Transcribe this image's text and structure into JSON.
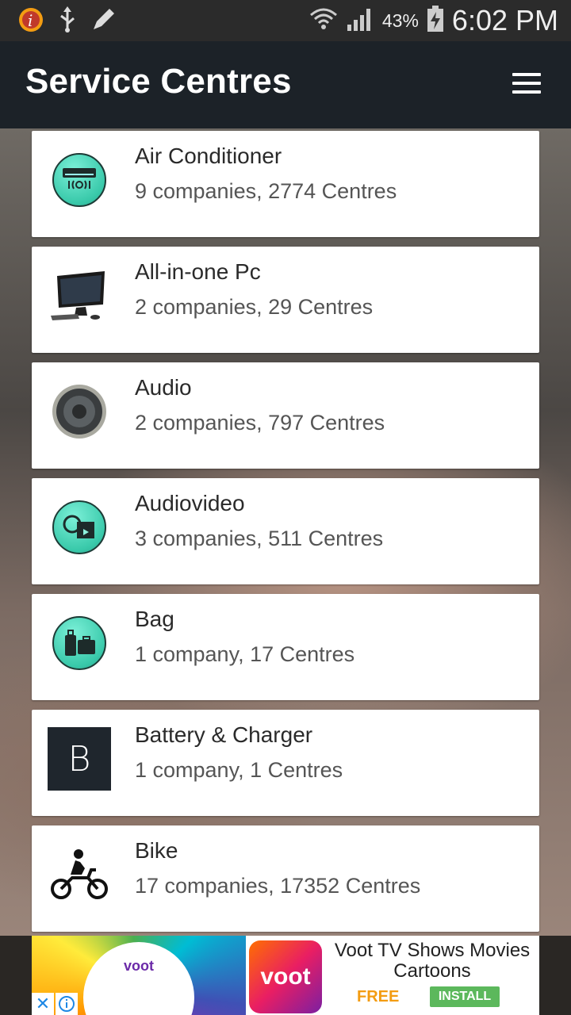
{
  "status_bar": {
    "battery_percent": "43%",
    "time": "6:02 PM"
  },
  "app_bar": {
    "title": "Service Centres"
  },
  "categories": [
    {
      "title": "Air Conditioner",
      "subtitle": "9 companies, 2774 Centres",
      "icon": "air-conditioner-icon"
    },
    {
      "title": "All-in-one Pc",
      "subtitle": "2 companies, 29 Centres",
      "icon": "all-in-one-pc-icon"
    },
    {
      "title": "Audio",
      "subtitle": "2 companies, 797 Centres",
      "icon": "speaker-icon"
    },
    {
      "title": "Audiovideo",
      "subtitle": "3 companies, 511 Centres",
      "icon": "audiovideo-icon"
    },
    {
      "title": "Bag",
      "subtitle": "1 company, 17 Centres",
      "icon": "luggage-icon"
    },
    {
      "title": "Battery & Charger",
      "subtitle": "1 company, 1 Centres",
      "icon": "letter-b-icon",
      "letter": "B"
    },
    {
      "title": "Bike",
      "subtitle": "17 companies, 17352 Centres",
      "icon": "motorbike-icon"
    }
  ],
  "ad": {
    "brand": "voot",
    "title": "Voot TV Shows Movies Cartoons",
    "free_label": "FREE",
    "install_label": "INSTALL",
    "install_color": "#5cb85c",
    "free_color": "#f39c12"
  },
  "colors": {
    "app_bar": "#1c2228",
    "status_bar": "#2b2b2b",
    "icon_teal": "#39c9aa"
  }
}
